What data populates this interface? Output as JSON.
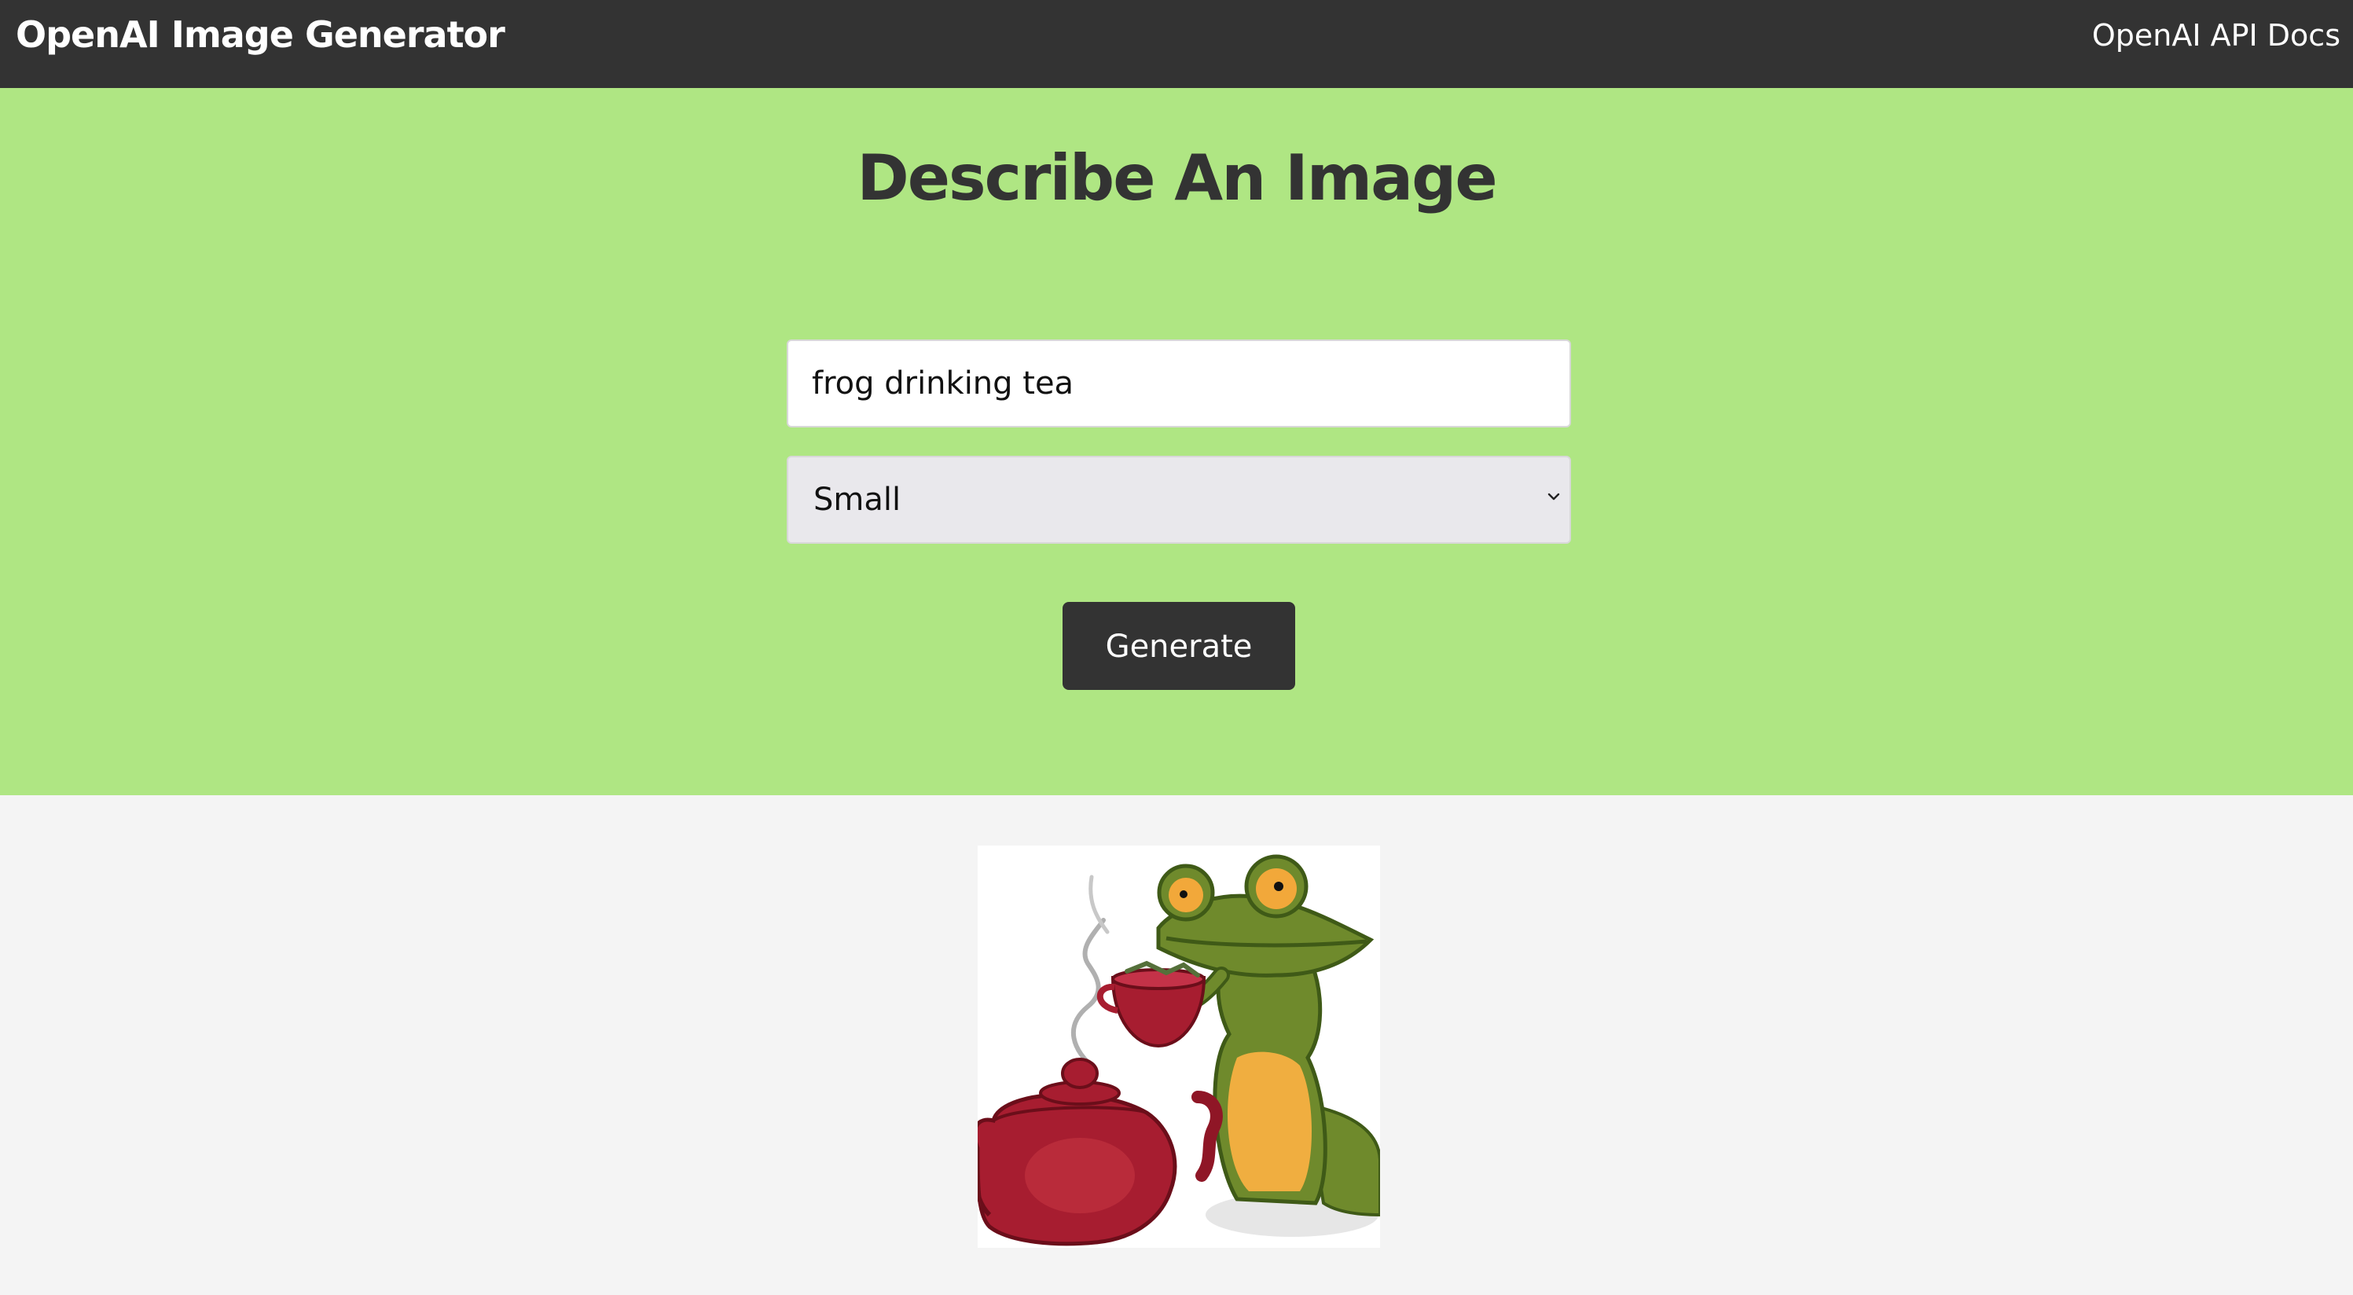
{
  "navbar": {
    "brand": "OpenAI Image Generator",
    "docs_link": "OpenAI API Docs"
  },
  "hero": {
    "title": "Describe An Image",
    "prompt_value": "frog drinking tea",
    "size_selected": "Small",
    "generate_label": "Generate"
  },
  "colors": {
    "navbar_bg": "#333333",
    "hero_bg": "#afe683",
    "page_bg": "#f4f4f4",
    "button_bg": "#333333"
  },
  "result": {
    "image_subject": "frog-with-teapot-and-teacup"
  }
}
